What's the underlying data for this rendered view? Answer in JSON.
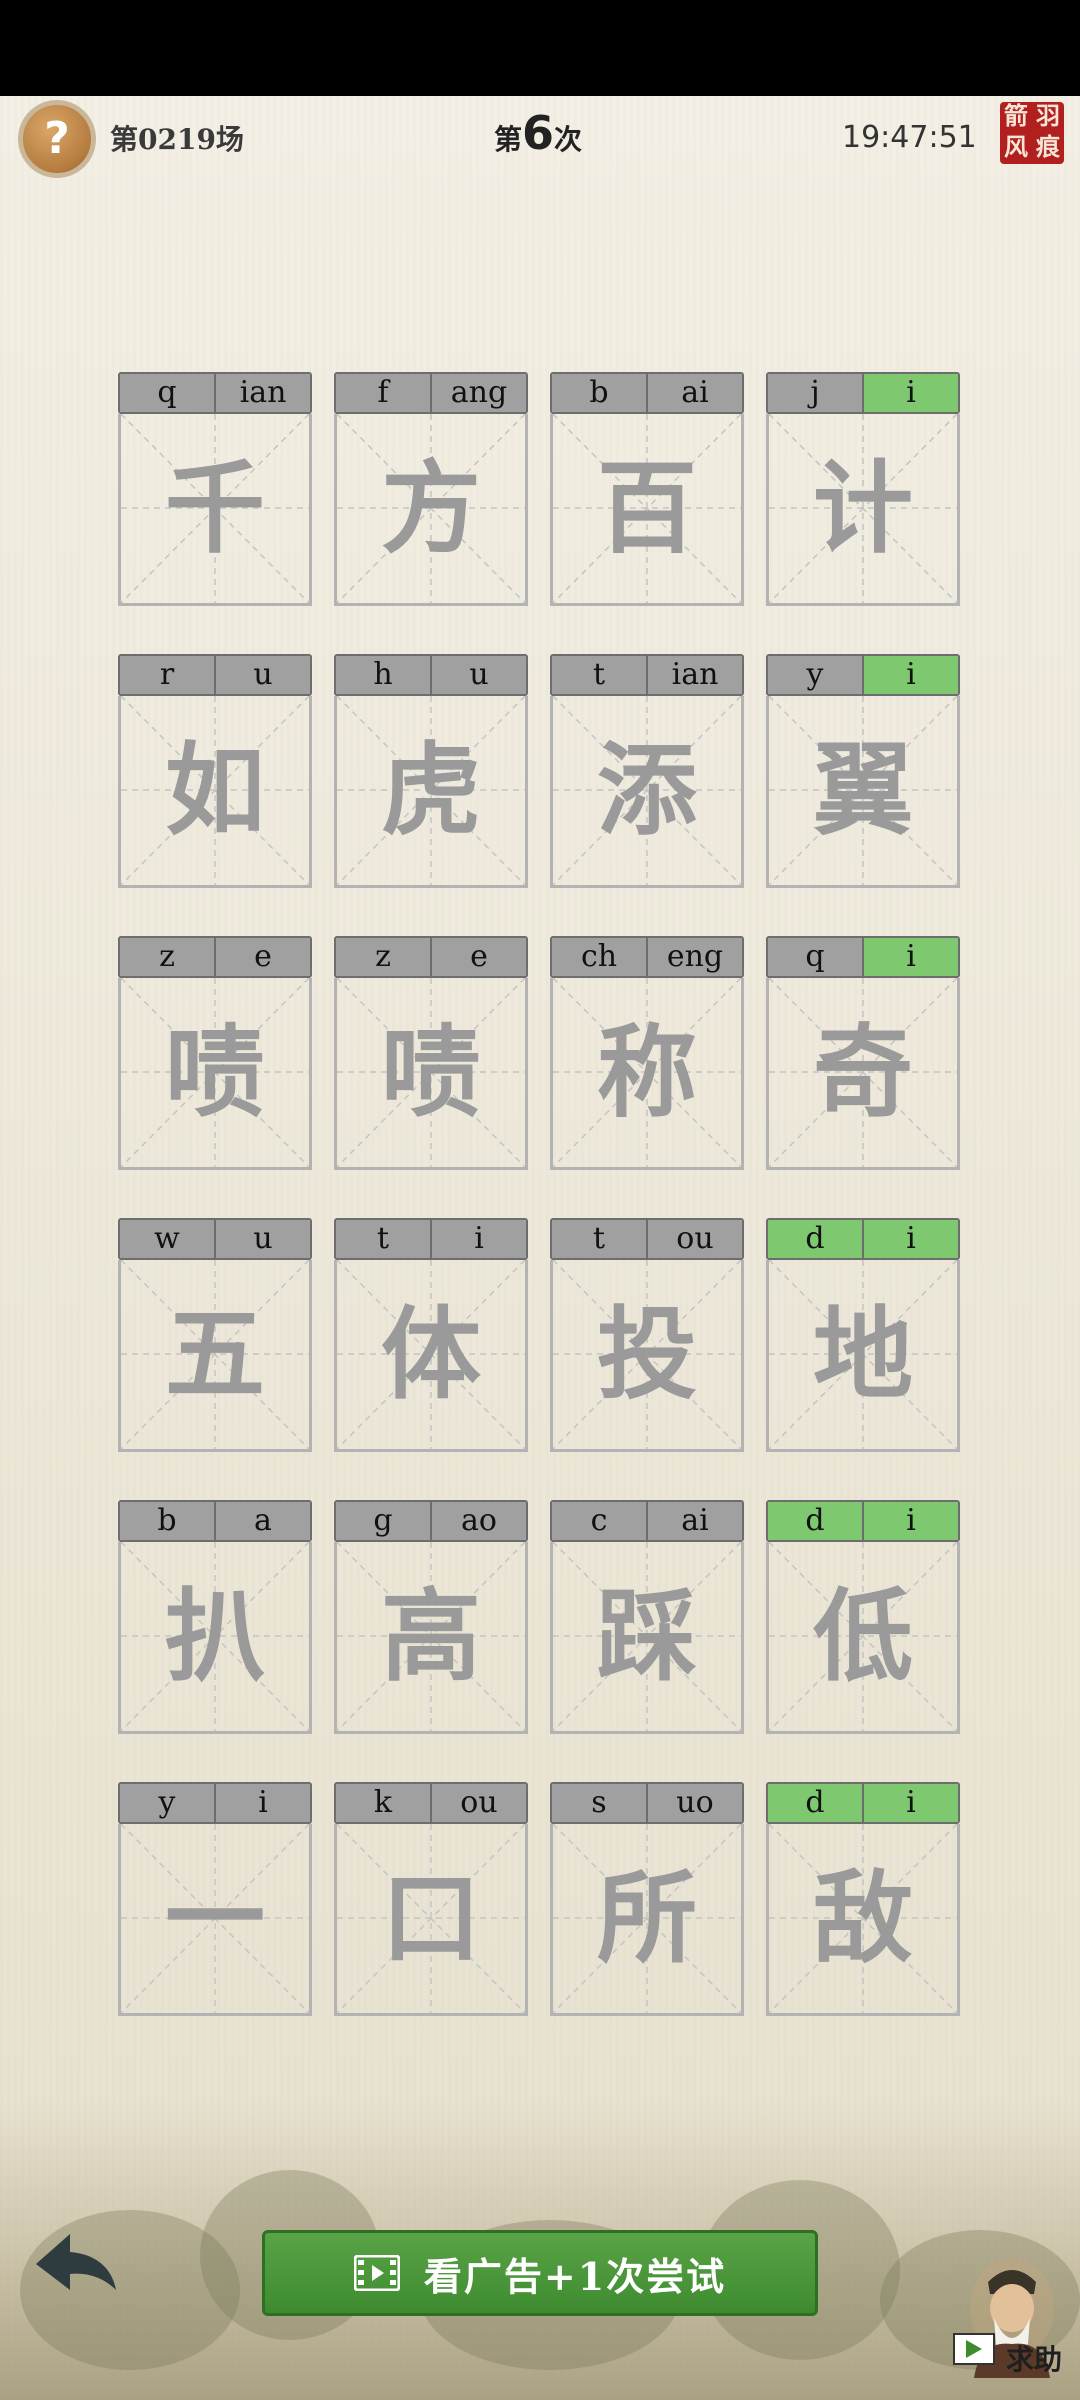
{
  "header": {
    "help_icon": "?",
    "round_label": "第0219场",
    "attempt_prefix": "第",
    "attempt_number": "6",
    "attempt_suffix": "次",
    "time": "19:47:51",
    "seal": [
      "箭",
      "羽",
      "风",
      "痕"
    ]
  },
  "colors": {
    "correct": "#7ec870",
    "pinyin_bg": "#a0a0a0",
    "hanzi": "#9a9a9a",
    "ad_button": "#4c9a3d"
  },
  "grid": [
    [
      {
        "initial": "q",
        "final": "ian",
        "char": "千",
        "initial_ok": false,
        "final_ok": false
      },
      {
        "initial": "f",
        "final": "ang",
        "char": "方",
        "initial_ok": false,
        "final_ok": false
      },
      {
        "initial": "b",
        "final": "ai",
        "char": "百",
        "initial_ok": false,
        "final_ok": false
      },
      {
        "initial": "j",
        "final": "i",
        "char": "计",
        "initial_ok": false,
        "final_ok": true
      }
    ],
    [
      {
        "initial": "r",
        "final": "u",
        "char": "如",
        "initial_ok": false,
        "final_ok": false
      },
      {
        "initial": "h",
        "final": "u",
        "char": "虎",
        "initial_ok": false,
        "final_ok": false
      },
      {
        "initial": "t",
        "final": "ian",
        "char": "添",
        "initial_ok": false,
        "final_ok": false
      },
      {
        "initial": "y",
        "final": "i",
        "char": "翼",
        "initial_ok": false,
        "final_ok": true
      }
    ],
    [
      {
        "initial": "z",
        "final": "e",
        "char": "啧",
        "initial_ok": false,
        "final_ok": false
      },
      {
        "initial": "z",
        "final": "e",
        "char": "啧",
        "initial_ok": false,
        "final_ok": false
      },
      {
        "initial": "ch",
        "final": "eng",
        "char": "称",
        "initial_ok": false,
        "final_ok": false
      },
      {
        "initial": "q",
        "final": "i",
        "char": "奇",
        "initial_ok": false,
        "final_ok": true
      }
    ],
    [
      {
        "initial": "w",
        "final": "u",
        "char": "五",
        "initial_ok": false,
        "final_ok": false
      },
      {
        "initial": "t",
        "final": "i",
        "char": "体",
        "initial_ok": false,
        "final_ok": false
      },
      {
        "initial": "t",
        "final": "ou",
        "char": "投",
        "initial_ok": false,
        "final_ok": false
      },
      {
        "initial": "d",
        "final": "i",
        "char": "地",
        "initial_ok": true,
        "final_ok": true
      }
    ],
    [
      {
        "initial": "b",
        "final": "a",
        "char": "扒",
        "initial_ok": false,
        "final_ok": false
      },
      {
        "initial": "g",
        "final": "ao",
        "char": "高",
        "initial_ok": false,
        "final_ok": false
      },
      {
        "initial": "c",
        "final": "ai",
        "char": "踩",
        "initial_ok": false,
        "final_ok": false
      },
      {
        "initial": "d",
        "final": "i",
        "char": "低",
        "initial_ok": true,
        "final_ok": true
      }
    ],
    [
      {
        "initial": "y",
        "final": "i",
        "char": "一",
        "initial_ok": false,
        "final_ok": false
      },
      {
        "initial": "k",
        "final": "ou",
        "char": "口",
        "initial_ok": false,
        "final_ok": false
      },
      {
        "initial": "s",
        "final": "uo",
        "char": "所",
        "initial_ok": false,
        "final_ok": false
      },
      {
        "initial": "d",
        "final": "i",
        "char": "敌",
        "initial_ok": true,
        "final_ok": true
      }
    ]
  ],
  "footer": {
    "ad_button_label": "看广告+1次尝试",
    "help_label": "求助",
    "back_icon": "back-arrow-icon",
    "film_icon": "film-icon"
  }
}
